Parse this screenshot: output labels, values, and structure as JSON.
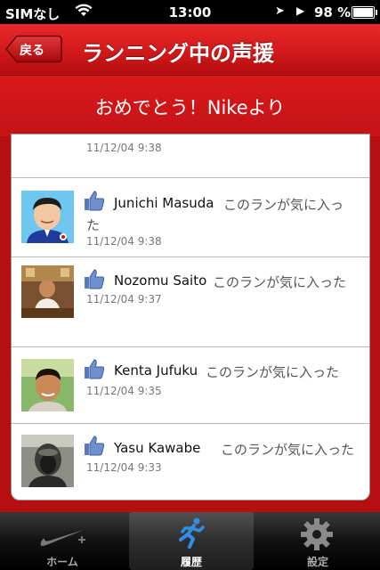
{
  "status_bar": {
    "carrier": "SIMなし",
    "time": "13:00",
    "battery": "98 %"
  },
  "nav": {
    "back_label": "戻る",
    "title": "ランニング中の声援"
  },
  "banner": {
    "text": "おめでとう！Nikeより"
  },
  "entries": [
    {
      "name": "",
      "message": "",
      "message_wrap": "",
      "timestamp": "11/12/04 9:38"
    },
    {
      "name": "Junichi Masuda",
      "message": "このランが気に入っ",
      "message_wrap": "た",
      "timestamp": "11/12/04 9:38"
    },
    {
      "name": "Nozomu Saito",
      "message": "このランが気に入った",
      "message_wrap": "",
      "timestamp": "11/12/04 9:37"
    },
    {
      "name": "Kenta Jufuku",
      "message": "このランが気に入った",
      "message_wrap": "",
      "timestamp": "11/12/04 9:35"
    },
    {
      "name": "Yasu Kawabe",
      "message": "このランが気に入った",
      "message_wrap": "",
      "timestamp": "11/12/04 9:33"
    }
  ],
  "tabs": [
    {
      "label": "ホーム",
      "icon": "nike-swoosh-icon",
      "active": false
    },
    {
      "label": "履歴",
      "icon": "runner-icon",
      "active": true
    },
    {
      "label": "設定",
      "icon": "gear-icon",
      "active": false
    }
  ],
  "colors": {
    "brand_red": "#d31a1c",
    "active_tab_icon": "#2f8fe6"
  }
}
